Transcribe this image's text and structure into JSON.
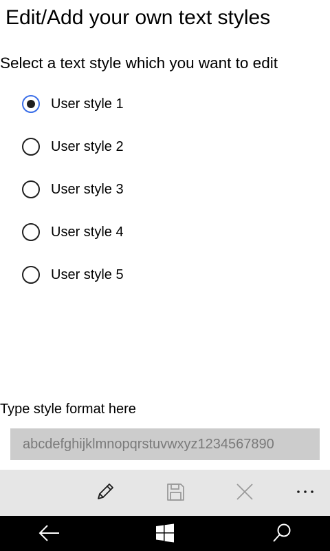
{
  "header": {
    "title": "Edit/Add your own text styles"
  },
  "instructions": {
    "select_prompt": "Select a text style which you want to edit"
  },
  "styles": [
    {
      "label": "User style 1",
      "selected": true
    },
    {
      "label": "User style 2",
      "selected": false
    },
    {
      "label": "User style 3",
      "selected": false
    },
    {
      "label": "User style 4",
      "selected": false
    },
    {
      "label": "User style 5",
      "selected": false
    }
  ],
  "format": {
    "label": "Type style format here",
    "value": "abcdefghijklmnopqrstuvwxyz1234567890"
  },
  "app_bar": {
    "buttons": [
      {
        "icon": "pencil-icon",
        "enabled": true
      },
      {
        "icon": "save-icon",
        "enabled": false
      },
      {
        "icon": "close-icon",
        "enabled": false
      },
      {
        "icon": "more-icon",
        "enabled": true
      }
    ]
  },
  "nav_bar": {
    "buttons": [
      "back-arrow-icon",
      "windows-icon",
      "search-icon"
    ]
  },
  "colors": {
    "radio_selected_ring": "#3a6ee8",
    "input_background": "#cccccc",
    "input_text": "#7a7a7a",
    "app_bar_background": "#e6e6e6",
    "app_bar_disabled_icon": "#9a9a9a",
    "nav_bar_background": "#000000"
  }
}
